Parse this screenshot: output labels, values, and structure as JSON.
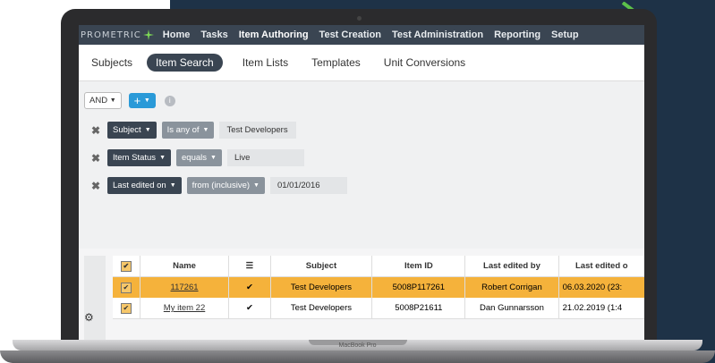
{
  "colors": {
    "background": "#1e3247",
    "nav": "#3a4552",
    "accent": "#2a9ad8",
    "selected_row": "#f5b23b",
    "arrow": "#5cc14a"
  },
  "device": {
    "label": "MacBook Pro"
  },
  "nav": {
    "logo": "PROMETRIC",
    "items": [
      "Home",
      "Tasks",
      "Item Authoring",
      "Test Creation",
      "Test Administration",
      "Reporting",
      "Setup"
    ],
    "active": "Item Authoring"
  },
  "subnav": {
    "items": [
      "Subjects",
      "Item Search",
      "Item Lists",
      "Templates",
      "Unit Conversions"
    ],
    "active": "Item Search"
  },
  "filters": {
    "logic": "AND",
    "add_label": "+",
    "info_label": "i",
    "rows": [
      {
        "field": "Subject",
        "operator": "Is any of",
        "value": "Test Developers"
      },
      {
        "field": "Item Status",
        "operator": "equals",
        "value": "Live"
      },
      {
        "field": "Last edited on",
        "operator": "from (inclusive)",
        "value": "01/01/2016"
      }
    ]
  },
  "table": {
    "columns": [
      "Name",
      "Subject",
      "Item ID",
      "Last edited by",
      "Last edited o"
    ],
    "rows": [
      {
        "name": "117261",
        "subject": "Test Developers",
        "item_id": "5008P117261",
        "edited_by": "Robert Corrigan",
        "edited_on": "06.03.2020 (23:",
        "selected": true
      },
      {
        "name": "My item 22",
        "subject": "Test Developers",
        "item_id": "5008P21611",
        "edited_by": "Dan Gunnarsson",
        "edited_on": "21.02.2019 (1:4",
        "selected": false
      }
    ]
  }
}
